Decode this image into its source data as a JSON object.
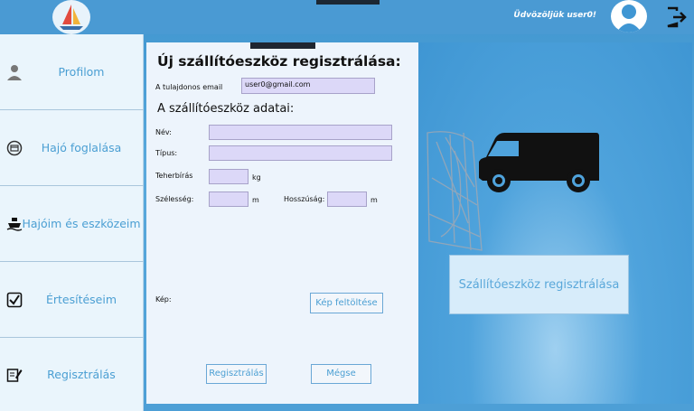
{
  "header": {
    "welcome": "Üdvözöljük user0!",
    "logo_icon": "sailboat-icon",
    "avatar_icon": "user-avatar-icon",
    "logout_icon": "logout-icon"
  },
  "sidebar": {
    "items": [
      {
        "label": "Profilom",
        "icon": "user-icon"
      },
      {
        "label": "Hajó foglalása",
        "icon": "calendar-icon"
      },
      {
        "label": "Hajóim és eszközeim",
        "icon": "ship-icon"
      },
      {
        "label": "Értesítéseim",
        "icon": "checkbox-icon"
      },
      {
        "label": "Regisztrálás",
        "icon": "edit-icon"
      }
    ]
  },
  "form": {
    "title": "Új szállítóeszköz regisztrálása:",
    "owner_email_label": "A tulajdonos email",
    "owner_email_value": "user0@gmail.com",
    "section_title": "A szállítóeszköz adatai:",
    "name_label": "Név:",
    "type_label": "Típus:",
    "capacity_label": "Teherbírás",
    "capacity_unit": "kg",
    "width_label": "Szélesség:",
    "width_unit": "m",
    "length_label": "Hosszúság:",
    "length_unit": "m",
    "image_label": "Kép:",
    "upload_button": "Kép feltöltése",
    "register_button": "Regisztrálás",
    "cancel_button": "Mégse"
  },
  "right_panel": {
    "title_button": "Szállítóeszköz regisztrálása",
    "vehicle_icon": "van-icon"
  },
  "colors": {
    "accent": "#4b9fd3",
    "input_bg": "#dcd8f8",
    "panel_bg": "#edf4fc"
  }
}
